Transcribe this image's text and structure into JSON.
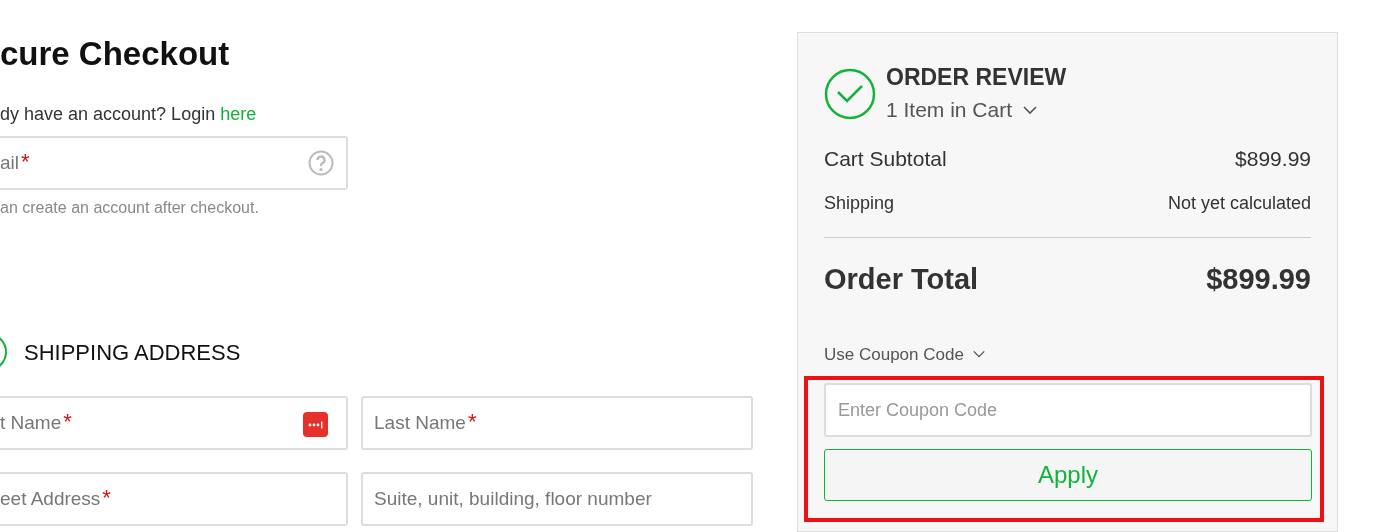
{
  "checkout": {
    "title": "cure Checkout",
    "login_prompt": "dy have an account? Login ",
    "login_link": "here",
    "email": {
      "placeholder": "ail",
      "marker": "*",
      "kind": "with_help"
    },
    "email_hint": "an create an account after checkout.",
    "shipping": {
      "title": "SHIPPING ADDRESS",
      "fields": [
        {
          "placeholder": "t Name",
          "marker": "*",
          "kind": "with_password_manager"
        },
        {
          "placeholder": "Last Name",
          "marker": "*",
          "kind": "plain"
        },
        {
          "placeholder": "eet Address",
          "marker": "*",
          "kind": "plain"
        },
        {
          "placeholder": "Suite, unit, building, floor number",
          "kind": "plain"
        }
      ]
    }
  },
  "order_review": {
    "title": "ORDER REVIEW",
    "cart_count": "1 Item in Cart",
    "lines": [
      {
        "label": "Cart Subtotal",
        "value": "$899.99",
        "kind": "subtotal"
      },
      {
        "label": "Shipping",
        "value": "Not yet calculated",
        "kind": "shipping"
      },
      {
        "label": "Order Total",
        "value": "$899.99",
        "kind": "total"
      }
    ],
    "coupon": {
      "toggle": "Use Coupon Code",
      "placeholder": "Enter Coupon Code",
      "button": "Apply",
      "highlighted": true
    }
  }
}
